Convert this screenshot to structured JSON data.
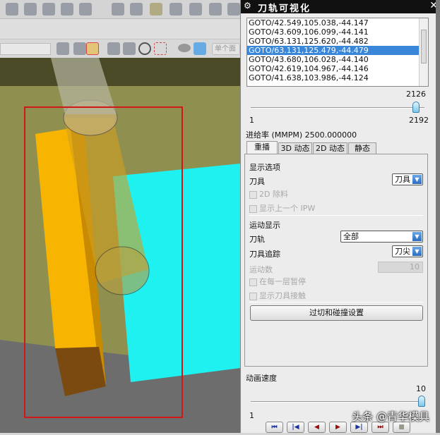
{
  "panel": {
    "title": "刀轨可视化",
    "list_items": [
      "GOTO/42.549,105.038,-44.147",
      "GOTO/43.609,106.099,-44.141",
      "GOTO/63.131,125.620,-44.482",
      "GOTO/63.131,125.479,-44.479",
      "GOTO/43.680,106.028,-44.140",
      "GOTO/42.619,104.967,-44.146",
      "GOTO/41.638,103.986,-44.124"
    ],
    "selected_index": 3,
    "slider": {
      "current": "2126",
      "min": "1",
      "max": "2192",
      "value": 2126
    },
    "feed_rate": "进给率 (MMPM) 2500.000000",
    "tabs": [
      "重播",
      "3D 动态",
      "2D 动态",
      "静态"
    ],
    "display_options": {
      "heading": "显示选项",
      "tool_label": "刀具",
      "tool_value": "刀具",
      "cb_2d": "2D 除料",
      "cb_ipw": "显示上一个 IPW"
    },
    "motion_display": {
      "heading": "运动显示",
      "path_label": "刀轨",
      "path_value": "全部",
      "trace_label": "刀具追踪",
      "trace_value": "刀尖",
      "motions_label": "运动数",
      "motions_value": "10",
      "cb_pause": "在每一层暂停",
      "cb_contact": "显示刀具接触"
    },
    "gouge_button": "过切和碰撞设置",
    "anim_speed": {
      "label": "动画速度",
      "current": "10",
      "min": "1",
      "value": 10
    },
    "playback": [
      "⏮",
      "|◀",
      "◀",
      "▶",
      "▶|",
      "⏭",
      "■"
    ]
  },
  "toolbar": {
    "filter_text": "单个面"
  },
  "watermark": "头条 @青华模具"
}
